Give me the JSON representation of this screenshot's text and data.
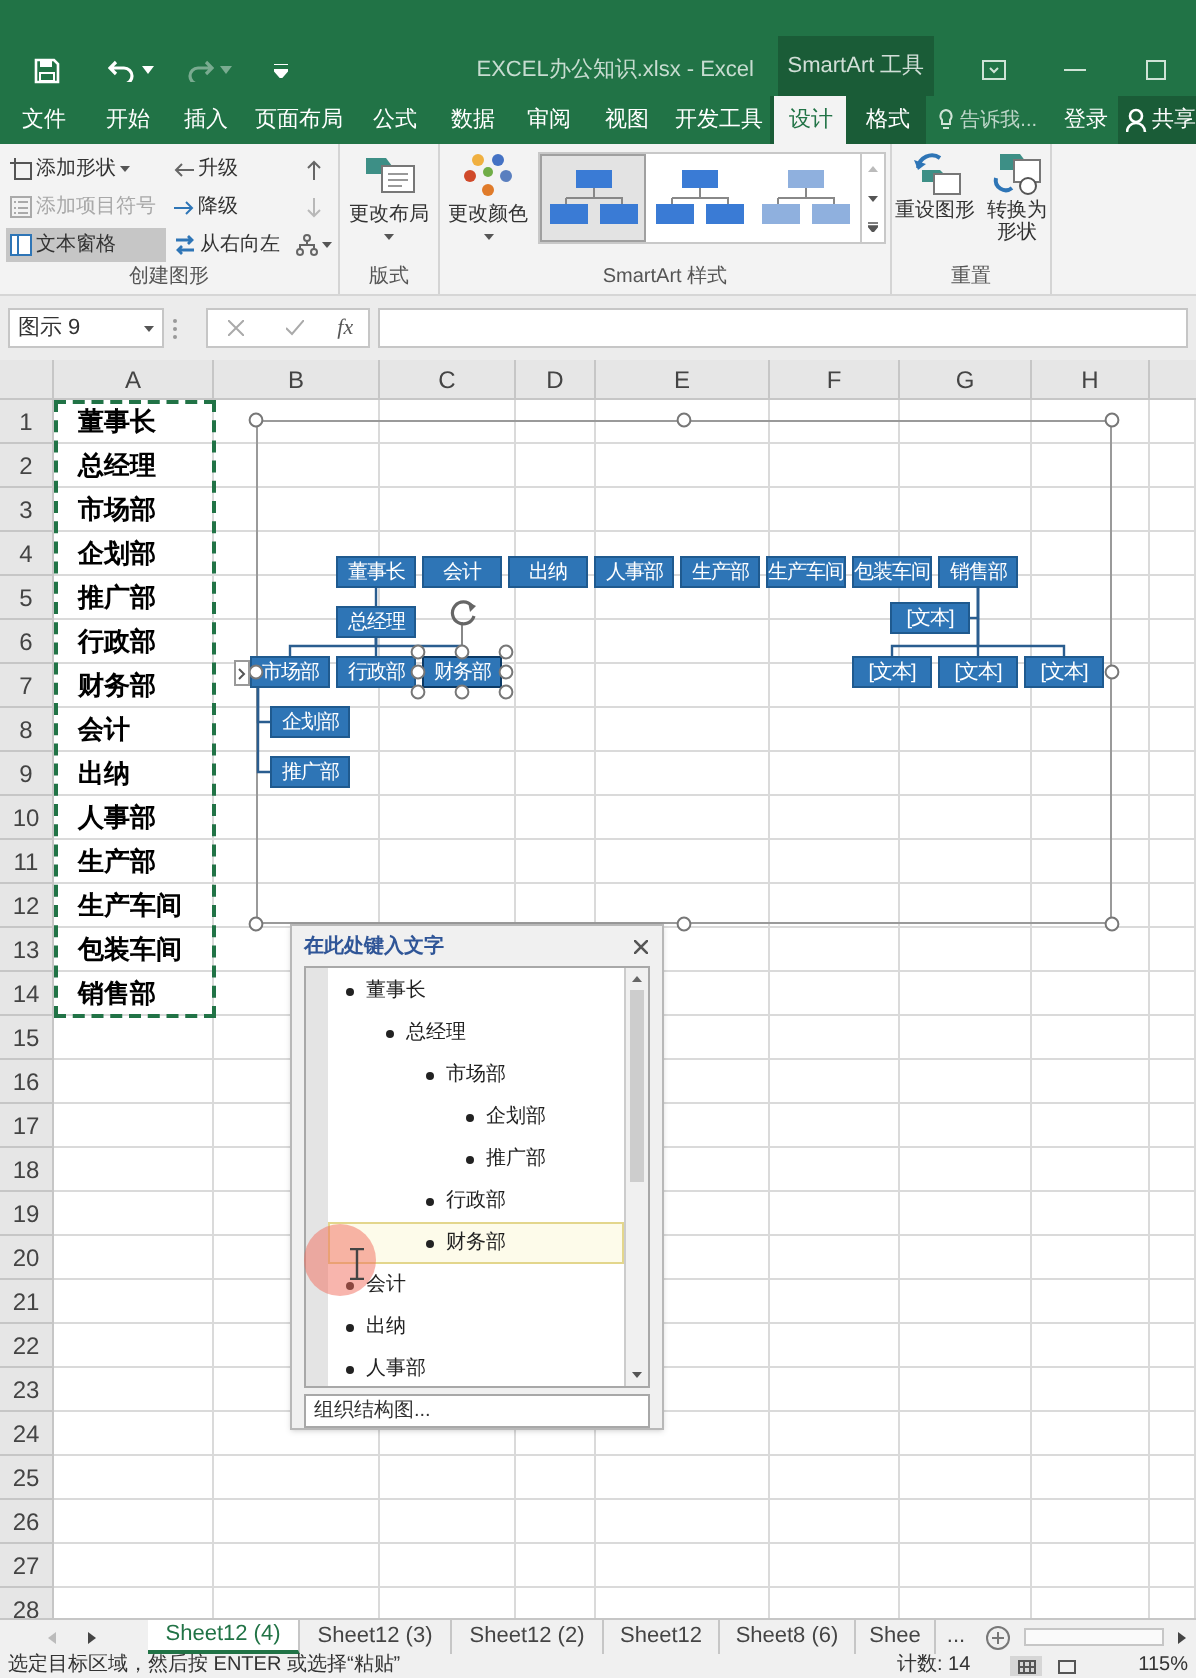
{
  "title_bar": {
    "title": "EXCEL办公知识.xlsx - Excel",
    "context_label": "SmartArt 工具"
  },
  "ribbon_tabs": [
    {
      "label": "文件",
      "selected": false,
      "contextual": false
    },
    {
      "label": "开始",
      "selected": false,
      "contextual": false
    },
    {
      "label": "插入",
      "selected": false,
      "contextual": false
    },
    {
      "label": "页面布局",
      "selected": false,
      "contextual": false
    },
    {
      "label": "公式",
      "selected": false,
      "contextual": false
    },
    {
      "label": "数据",
      "selected": false,
      "contextual": false
    },
    {
      "label": "审阅",
      "selected": false,
      "contextual": false
    },
    {
      "label": "视图",
      "selected": false,
      "contextual": false
    },
    {
      "label": "开发工具",
      "selected": false,
      "contextual": false
    },
    {
      "label": "设计",
      "selected": true,
      "contextual": true
    },
    {
      "label": "格式",
      "selected": false,
      "contextual": true
    }
  ],
  "tell_me": {
    "placeholder": "告诉我..."
  },
  "sign_in": "登录",
  "share": "共享",
  "ribbon_groups": [
    {
      "kind": "create",
      "label": "创建图形",
      "commands": [
        {
          "label": "添加形状",
          "dropdown": true,
          "disabled": false,
          "on": false
        },
        {
          "label": "添加项目符号",
          "dropdown": false,
          "disabled": true,
          "on": false
        },
        {
          "label": "文本窗格",
          "dropdown": false,
          "disabled": false,
          "on": true
        },
        {
          "label": "升级",
          "dropdown": false,
          "disabled": false,
          "on": false
        },
        {
          "label": "降级",
          "dropdown": false,
          "disabled": false,
          "on": false
        },
        {
          "label": "从右向左",
          "dropdown": false,
          "disabled": false,
          "on": false
        }
      ],
      "icon_commands": [
        {
          "kind": "up",
          "disabled": false
        },
        {
          "kind": "down",
          "disabled": true
        },
        {
          "kind": "layout",
          "disabled": false
        }
      ]
    },
    {
      "kind": "layouts",
      "label": "版式",
      "commands": [
        {
          "label": "更改布局",
          "dropdown": true
        }
      ]
    },
    {
      "kind": "styles",
      "label": "SmartArt 样式",
      "commands": [
        {
          "label": "更改颜色",
          "dropdown": true
        }
      ],
      "styles": [
        {
          "selected": true
        },
        {
          "selected": false
        },
        {
          "selected": false
        }
      ]
    },
    {
      "kind": "reset",
      "label": "重置",
      "commands": [
        {
          "label": "重设图形",
          "dropdown": false
        },
        {
          "label": "转换为形状",
          "dropdown": false
        }
      ]
    }
  ],
  "formula_bar": {
    "name_box": "图示 9",
    "fx": "fx"
  },
  "sheet": {
    "columns": [
      "A",
      "B",
      "C",
      "D",
      "E",
      "F",
      "G",
      "H"
    ],
    "rows": [
      "1",
      "2",
      "3",
      "4",
      "5",
      "6",
      "7",
      "8",
      "9",
      "10",
      "11",
      "12",
      "13",
      "14",
      "15",
      "16",
      "17",
      "18",
      "19",
      "20",
      "21",
      "22",
      "23",
      "24",
      "25",
      "26",
      "27",
      "28"
    ],
    "column_a": [
      "董事长",
      "总经理",
      "市场部",
      "企划部",
      "推广部",
      "行政部",
      "财务部",
      "会计",
      "出纳",
      "人事部",
      "生产部",
      "生产车间",
      "包装车间",
      "销售部"
    ]
  },
  "smartart": {
    "nodes": [
      {
        "text": "董事长",
        "selected": false,
        "children": [
          {
            "text": "总经理",
            "selected": false,
            "children": [
              {
                "text": "市场部",
                "selected": false,
                "children": [
                  {
                    "text": "企划部",
                    "selected": false
                  },
                  {
                    "text": "推广部",
                    "selected": false
                  }
                ]
              },
              {
                "text": "行政部",
                "selected": false
              },
              {
                "text": "财务部",
                "selected": true
              }
            ]
          }
        ]
      },
      {
        "text": "会计",
        "selected": false
      },
      {
        "text": "出纳",
        "selected": false
      },
      {
        "text": "人事部",
        "selected": false
      },
      {
        "text": "生产部",
        "selected": false
      },
      {
        "text": "生产车间",
        "selected": false
      },
      {
        "text": "包装车间",
        "selected": false
      },
      {
        "text": "销售部",
        "selected": false,
        "assistant": {
          "text": "[文本]",
          "selected": false
        },
        "children": [
          {
            "text": "[文本]",
            "selected": false
          },
          {
            "text": "[文本]",
            "selected": false
          },
          {
            "text": "[文本]",
            "selected": false
          }
        ]
      }
    ]
  },
  "text_pane": {
    "title": "在此处键入文字",
    "items": [
      {
        "text": "董事长",
        "selected": false,
        "children": [
          {
            "text": "总经理",
            "selected": false,
            "children": [
              {
                "text": "市场部",
                "selected": false,
                "children": [
                  {
                    "text": "企划部",
                    "selected": false
                  },
                  {
                    "text": "推广部",
                    "selected": false
                  }
                ]
              },
              {
                "text": "行政部",
                "selected": false
              },
              {
                "text": "财务部",
                "selected": true
              }
            ]
          }
        ]
      },
      {
        "text": "会计",
        "selected": false
      },
      {
        "text": "出纳",
        "selected": false
      },
      {
        "text": "人事部",
        "selected": false
      }
    ],
    "footer": "组织结构图..."
  },
  "sheet_tabs": [
    {
      "label": "Sheet12 (4)",
      "selected": true
    },
    {
      "label": "Sheet12 (3)",
      "selected": false
    },
    {
      "label": "Sheet12 (2)",
      "selected": false
    },
    {
      "label": "Sheet12",
      "selected": false
    },
    {
      "label": "Sheet8 (6)",
      "selected": false
    },
    {
      "label": "Shee",
      "selected": false
    }
  ],
  "more_sheets": "...",
  "status_bar": {
    "message": "选定目标区域，然后按 ENTER 或选择“粘贴”",
    "count": "计数: 14",
    "zoom": "115%"
  }
}
